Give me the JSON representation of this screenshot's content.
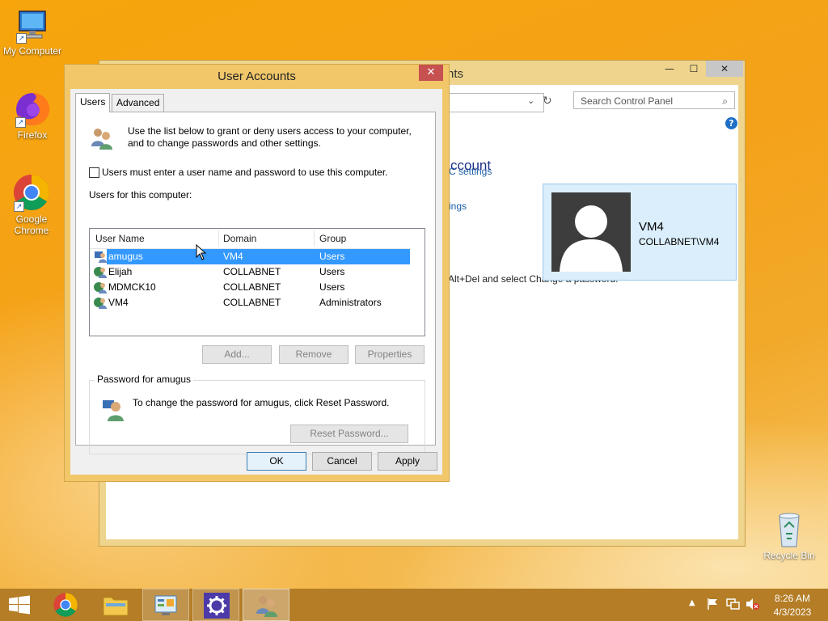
{
  "desktop": {
    "icons": [
      {
        "label": "My Computer"
      },
      {
        "label": "Firefox"
      },
      {
        "label": "Google Chrome"
      },
      {
        "label": "Recycle Bin"
      }
    ]
  },
  "control_panel": {
    "title_fragment": "nts",
    "search_placeholder": "Search Control Panel",
    "heading_fragment": "ccount",
    "link_uac_fragment": "C settings",
    "link_settings_fragment": "ings",
    "body_fragment": "Alt+Del and select Change a password.",
    "user": {
      "name": "VM4",
      "domain": "COLLABNET\\VM4"
    },
    "help_glyph": "?"
  },
  "dialog": {
    "title": "User Accounts",
    "close_glyph": "✕",
    "tabs": [
      {
        "label": "Users"
      },
      {
        "label": "Advanced"
      }
    ],
    "intro_line1": "Use the list below to grant or deny users access to your computer,",
    "intro_line2": "and to change passwords and other settings.",
    "checkbox_label": "Users must enter a user name and password to use this computer.",
    "checkbox_checked": false,
    "list_caption": "Users for this computer:",
    "columns": [
      "User Name",
      "Domain",
      "Group"
    ],
    "users": [
      {
        "name": "amugus",
        "domain": "VM4",
        "group": "Users",
        "selected": true
      },
      {
        "name": "Elijah",
        "domain": "COLLABNET",
        "group": "Users",
        "selected": false
      },
      {
        "name": "MDMCK10",
        "domain": "COLLABNET",
        "group": "Users",
        "selected": false
      },
      {
        "name": "VM4",
        "domain": "COLLABNET",
        "group": "Administrators",
        "selected": false
      }
    ],
    "buttons": {
      "add": "Add...",
      "remove": "Remove",
      "properties": "Properties"
    },
    "password_group": {
      "label": "Password for amugus",
      "text": "To change the password for amugus, click Reset Password.",
      "reset_button": "Reset Password..."
    },
    "footer": {
      "ok": "OK",
      "cancel": "Cancel",
      "apply": "Apply"
    }
  },
  "taskbar": {
    "time": "8:26 AM",
    "date": "4/3/2023"
  }
}
